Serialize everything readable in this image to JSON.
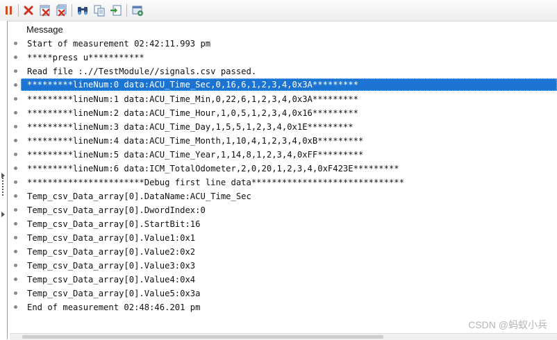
{
  "toolbar": {
    "buttons": [
      {
        "name": "pause-icon"
      },
      {
        "name": "delete-icon"
      },
      {
        "name": "clear-icon"
      },
      {
        "name": "clear-all-icon"
      },
      {
        "name": "find-icon"
      },
      {
        "name": "copy-icon"
      },
      {
        "name": "export-icon"
      },
      {
        "name": "config-icon"
      }
    ]
  },
  "list": {
    "column_header": "Message",
    "messages": [
      "Start of measurement 02:42:11.993 pm",
      "*****press u***********",
      "Read file :.//TestModule//signals.csv passed.",
      "*********lineNum:0 data:ACU_Time_Sec,0,16,6,1,2,3,4,0x3A*********",
      "*********lineNum:1 data:ACU_Time_Min,0,22,6,1,2,3,4,0x3A*********",
      "*********lineNum:2 data:ACU_Time_Hour,1,0,5,1,2,3,4,0x16*********",
      "*********lineNum:3 data:ACU_Time_Day,1,5,5,1,2,3,4,0x1E*********",
      "*********lineNum:4 data:ACU_Time_Month,1,10,4,1,2,3,4,0xB*********",
      "*********lineNum:5 data:ACU_Time_Year,1,14,8,1,2,3,4,0xFF*********",
      "*********lineNum:6 data:ICM_TotalOdometer,2,0,20,1,2,3,4,0xF423E*********",
      "***********************Debug first line data******************************",
      "Temp_csv_Data_array[0].DataName:ACU_Time_Sec",
      "Temp_csv_Data_array[0].DwordIndex:0",
      "Temp_csv_Data_array[0].StartBit:16",
      "Temp_csv_Data_array[0].Value1:0x1",
      "Temp_csv_Data_array[0].Value2:0x2",
      "Temp_csv_Data_array[0].Value3:0x3",
      "Temp_csv_Data_array[0].Value4:0x4",
      "Temp_csv_Data_array[0].Value5:0x3a",
      "End of measurement 02:48:46.201 pm"
    ],
    "selected_index": 3
  },
  "watermark": "CSDN @蚂蚁小兵",
  "colors": {
    "selection": "#1c74d2",
    "bullet": "#8a8a8a"
  }
}
